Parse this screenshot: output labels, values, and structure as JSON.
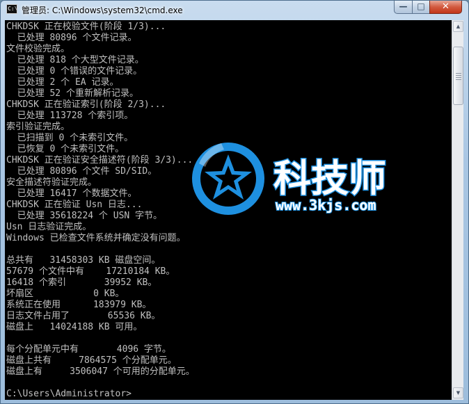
{
  "window": {
    "title": "管理员: C:\\Windows\\system32\\cmd.exe",
    "icon_text": "C:\\",
    "controls": {
      "minimize": "—",
      "maximize": "□",
      "close": "✕"
    }
  },
  "console": {
    "lines": [
      "CHKDSK 正在校验文件(阶段 1/3)...",
      "  已处理 80896 个文件记录。",
      "文件校验完成。",
      "  已处理 818 个大型文件记录。",
      "  已处理 0 个错误的文件记录。",
      "  已处理 2 个 EA 记录。",
      "  已处理 52 个重新解析记录。",
      "CHKDSK 正在验证索引(阶段 2/3)...",
      "  已处理 113728 个索引项。",
      "索引验证完成。",
      "  已扫描到 0 个未索引文件。",
      "  已恢复 0 个未索引文件。",
      "CHKDSK 正在验证安全描述符(阶段 3/3)...",
      "  已处理 80896 个文件 SD/SID。",
      "安全描述符验证完成。",
      "  已处理 16417 个数据文件。",
      "CHKDSK 正在验证 Usn 日志...",
      "  已处理 35618224 个 USN 字节。",
      "Usn 日志验证完成。",
      "Windows 已检查文件系统并确定没有问题。",
      "",
      "总共有   31458303 KB 磁盘空间。",
      "57679 个文件中有    17210184 KB。",
      "16418 个索引       39952 KB。",
      "坏扇区           0 KB。",
      "系统正在使用      183979 KB。",
      "日志文件占用了       65536 KB。",
      "磁盘上   14024188 KB 可用。",
      "",
      "每个分配单元中有       4096 字节。",
      "磁盘上共有     7864575 个分配单元。",
      "磁盘上有     3506047 个可用的分配单元。",
      "",
      "C:\\Users\\Administrator>"
    ]
  },
  "watermark": {
    "name": "科技师",
    "url": "www.3kjs.com",
    "color": "#1e90e0"
  },
  "colors": {
    "console_bg": "#000000",
    "console_text": "#c0c0c0"
  }
}
